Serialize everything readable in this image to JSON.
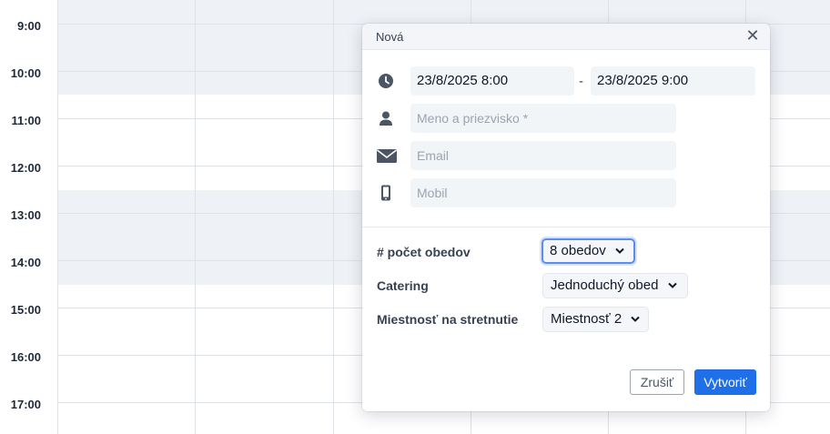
{
  "calendar": {
    "times": [
      "9:00",
      "10:00",
      "11:00",
      "12:00",
      "13:00",
      "14:00",
      "15:00",
      "16:00",
      "17:00"
    ]
  },
  "modal": {
    "title": "Nová",
    "close_symbol": "✕",
    "start_datetime": "23/8/2025  8:00",
    "separator": "-",
    "end_datetime": "23/8/2025  9:00",
    "name_placeholder": "Meno a priezvisko *",
    "email_placeholder": "Email",
    "phone_placeholder": "Mobil",
    "icons": [
      "clock-icon",
      "person-icon",
      "envelope-icon",
      "phone-icon"
    ]
  },
  "options": {
    "lunch_count_label": "# počet obedov",
    "lunch_count_value": "8 obedov",
    "catering_label": "Catering",
    "catering_value": "Jednoduchý obed",
    "room_label": "Miestnosť na stretnutie",
    "room_value": "Miestnosť 2"
  },
  "actions": {
    "cancel_label": "Zrušiť",
    "create_label": "Vytvoriť"
  },
  "colors": {
    "primary": "#1f6fe8",
    "shade": "#eef2f6",
    "focus": "#5b8def"
  }
}
